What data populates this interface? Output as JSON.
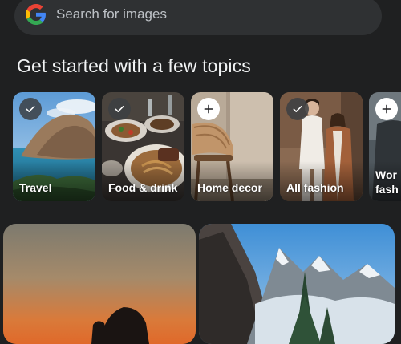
{
  "search": {
    "placeholder": "Search for images",
    "logo_icon": "google-g-icon"
  },
  "section": {
    "title": "Get started with a few topics"
  },
  "topics": [
    {
      "label": "Travel",
      "state": "selected",
      "badge_icon": "check-icon"
    },
    {
      "label": "Food & drink",
      "state": "selected",
      "badge_icon": "check-icon"
    },
    {
      "label": "Home decor",
      "state": "unselected",
      "badge_icon": "plus-icon"
    },
    {
      "label": "All fashion",
      "state": "selected",
      "badge_icon": "check-icon"
    },
    {
      "label": "Wor fash",
      "state": "unselected",
      "badge_icon": "plus-icon"
    }
  ],
  "results": [
    {
      "image": "sunset-silhouette-photo"
    },
    {
      "image": "mountain-lake-photo"
    }
  ],
  "colors": {
    "background": "#1f2021",
    "search_bg": "#2f3133",
    "title_text": "#f1f3f4",
    "placeholder_text": "#bdc1c6"
  }
}
